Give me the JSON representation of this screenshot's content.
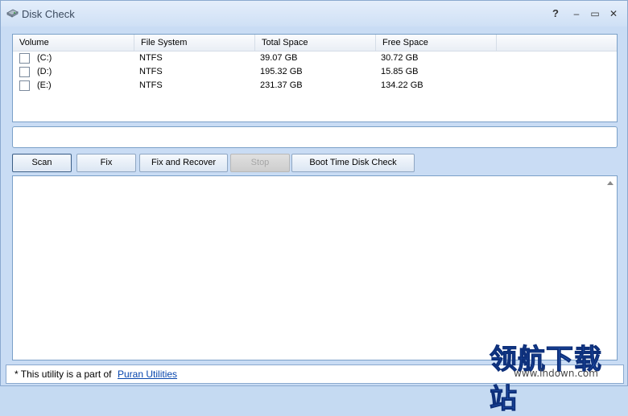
{
  "window": {
    "title": "Disk Check"
  },
  "titlebar": {
    "help": "?",
    "minimize": "‒",
    "maximize": "▭",
    "close": "✕"
  },
  "icons": {
    "app": "disk-icon",
    "help": "help-icon",
    "minimize": "minimize-icon",
    "maximize": "maximize-icon",
    "close": "close-icon",
    "scroll": "scroll-up-arrow-icon"
  },
  "volumes": {
    "headers": [
      "Volume",
      "File System",
      "Total Space",
      "Free Space"
    ],
    "rows": [
      {
        "volume": "(C:)",
        "fs": "NTFS",
        "total": "39.07 GB",
        "free": "30.72 GB",
        "checked": false
      },
      {
        "volume": "(D:)",
        "fs": "NTFS",
        "total": "195.32 GB",
        "free": "15.85 GB",
        "checked": false
      },
      {
        "volume": "(E:)",
        "fs": "NTFS",
        "total": "231.37 GB",
        "free": "134.22 GB",
        "checked": false
      }
    ]
  },
  "status_field": {
    "value": ""
  },
  "buttons": {
    "scan": "Scan",
    "fix": "Fix",
    "fix_recover": "Fix and Recover",
    "stop": "Stop",
    "boot": "Boot Time Disk Check"
  },
  "log": {
    "text": ""
  },
  "footer": {
    "text": "* This utility is a part of",
    "link": "Puran Utilities"
  },
  "watermark": {
    "cn": "领航下载站",
    "url": "www.lhdown.com"
  },
  "colors": {
    "window_bg": "#c9dcf4",
    "border": "#7aa0c8",
    "link": "#0645ad",
    "watermark": "#2a63c7"
  }
}
